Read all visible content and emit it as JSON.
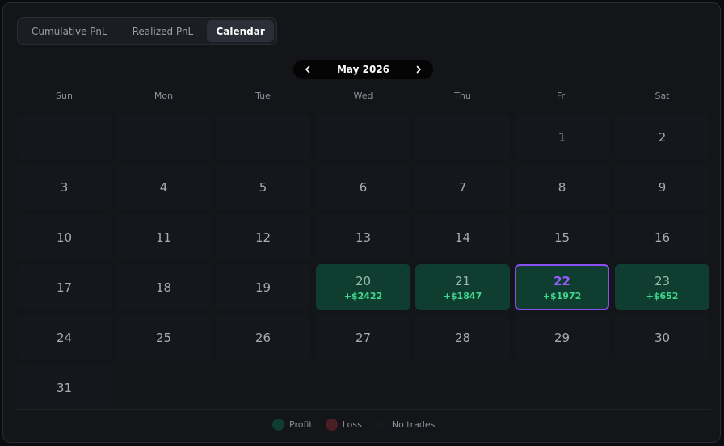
{
  "tabs": [
    {
      "label": "Cumulative PnL",
      "active": false
    },
    {
      "label": "Realized PnL",
      "active": false
    },
    {
      "label": "Calendar",
      "active": true
    }
  ],
  "month_nav": {
    "label": "May 2026",
    "prev_icon": "chevron-left-icon",
    "next_icon": "chevron-right-icon"
  },
  "weekdays": [
    "Sun",
    "Mon",
    "Tue",
    "Wed",
    "Thu",
    "Fri",
    "Sat"
  ],
  "calendar": {
    "first_weekday_index": 5,
    "days_in_month": 31,
    "today": 22,
    "trades": {
      "20": "+$2422",
      "21": "+$1847",
      "22": "+$1972",
      "23": "+$652"
    }
  },
  "legend": [
    {
      "label": "Profit",
      "color": "#0f3d30"
    },
    {
      "label": "Loss",
      "color": "#4a1f24"
    },
    {
      "label": "No trades",
      "color": "#16171c"
    }
  ],
  "colors": {
    "profit_bg": "#0f3d30",
    "profit_text": "#3fd68d",
    "today_border": "#8a4ff0"
  }
}
